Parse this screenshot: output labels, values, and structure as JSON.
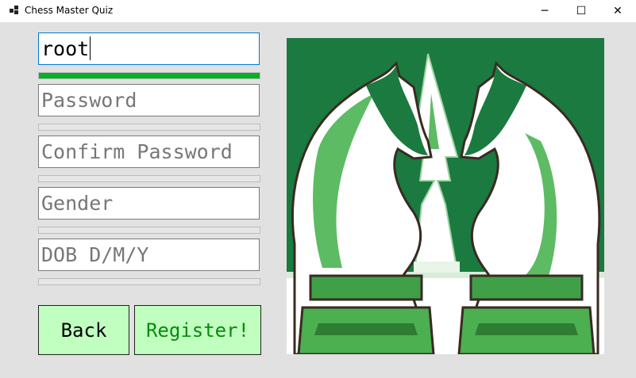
{
  "window": {
    "title": "Chess Master Quiz",
    "controls": {
      "minimize": "─",
      "maximize": "☐",
      "close": "✕"
    }
  },
  "form": {
    "username": {
      "value": "root",
      "strength": 1.0
    },
    "password": {
      "placeholder": "Password",
      "strength": 0
    },
    "confirm_password": {
      "placeholder": "Confirm Password",
      "strength": 0
    },
    "gender": {
      "placeholder": "Gender",
      "strength": 0
    },
    "dob": {
      "placeholder": "DOB D/M/Y",
      "strength": 0
    }
  },
  "buttons": {
    "back": "Back",
    "register": "Register!"
  },
  "colors": {
    "progress_fill": "#06b025",
    "button_bg": "#c0ffc0",
    "register_text": "#0a8a0a",
    "art_green": "#1b7a3f",
    "art_light_green": "#5dbb63"
  },
  "image": {
    "subject": "two chess knights facing each other with a pawn between them"
  }
}
